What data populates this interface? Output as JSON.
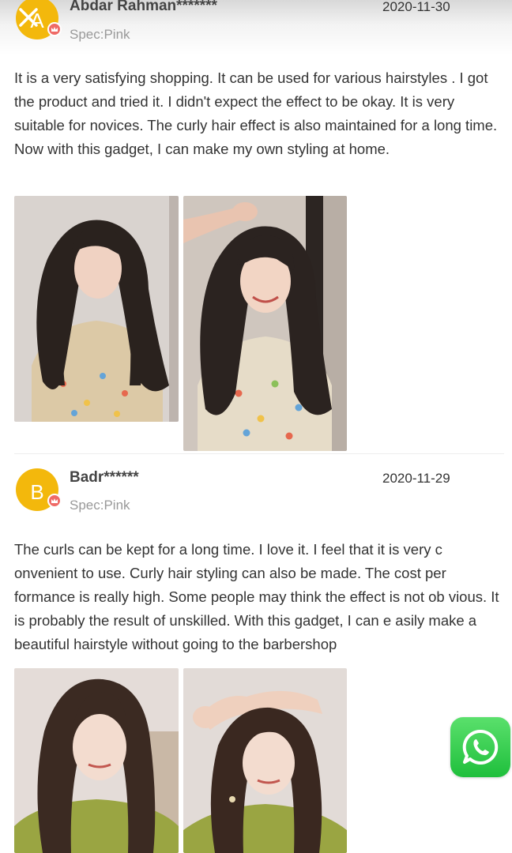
{
  "reviews": [
    {
      "avatar_letter": "A",
      "name": "Abdar Rahman*******",
      "date": "2020-11-30",
      "spec": "Spec:Pink",
      "text": "It is a very satisfying shopping. It can be used for various hairstyles . I got the product and tried it. I didn't expect the effect to be okay. It is very suitable for novices. The curly hair effect is also maintained for a long time. Now with this gadget, I can make my own styling at home."
    },
    {
      "avatar_letter": "B",
      "name": "Badr******",
      "date": "2020-11-29",
      "spec": "Spec:Pink",
      "text": "The curls can be kept for a long time. I love it. I feel that it is very c onvenient to use. Curly hair styling can also be made. The cost per formance is really high. Some people may think the effect is not ob vious. It is probably the result of unskilled. With this gadget, I can e asily make a beautiful hairstyle without going to the barbershop"
    }
  ],
  "icons": {
    "close": "close-icon",
    "vip": "vip-crown-icon",
    "whatsapp": "whatsapp-icon"
  },
  "colors": {
    "avatar": "#f3b80c",
    "vip_badge": "#ef6a66",
    "whatsapp": "#25d366",
    "shirt_green": "#9aa542"
  }
}
